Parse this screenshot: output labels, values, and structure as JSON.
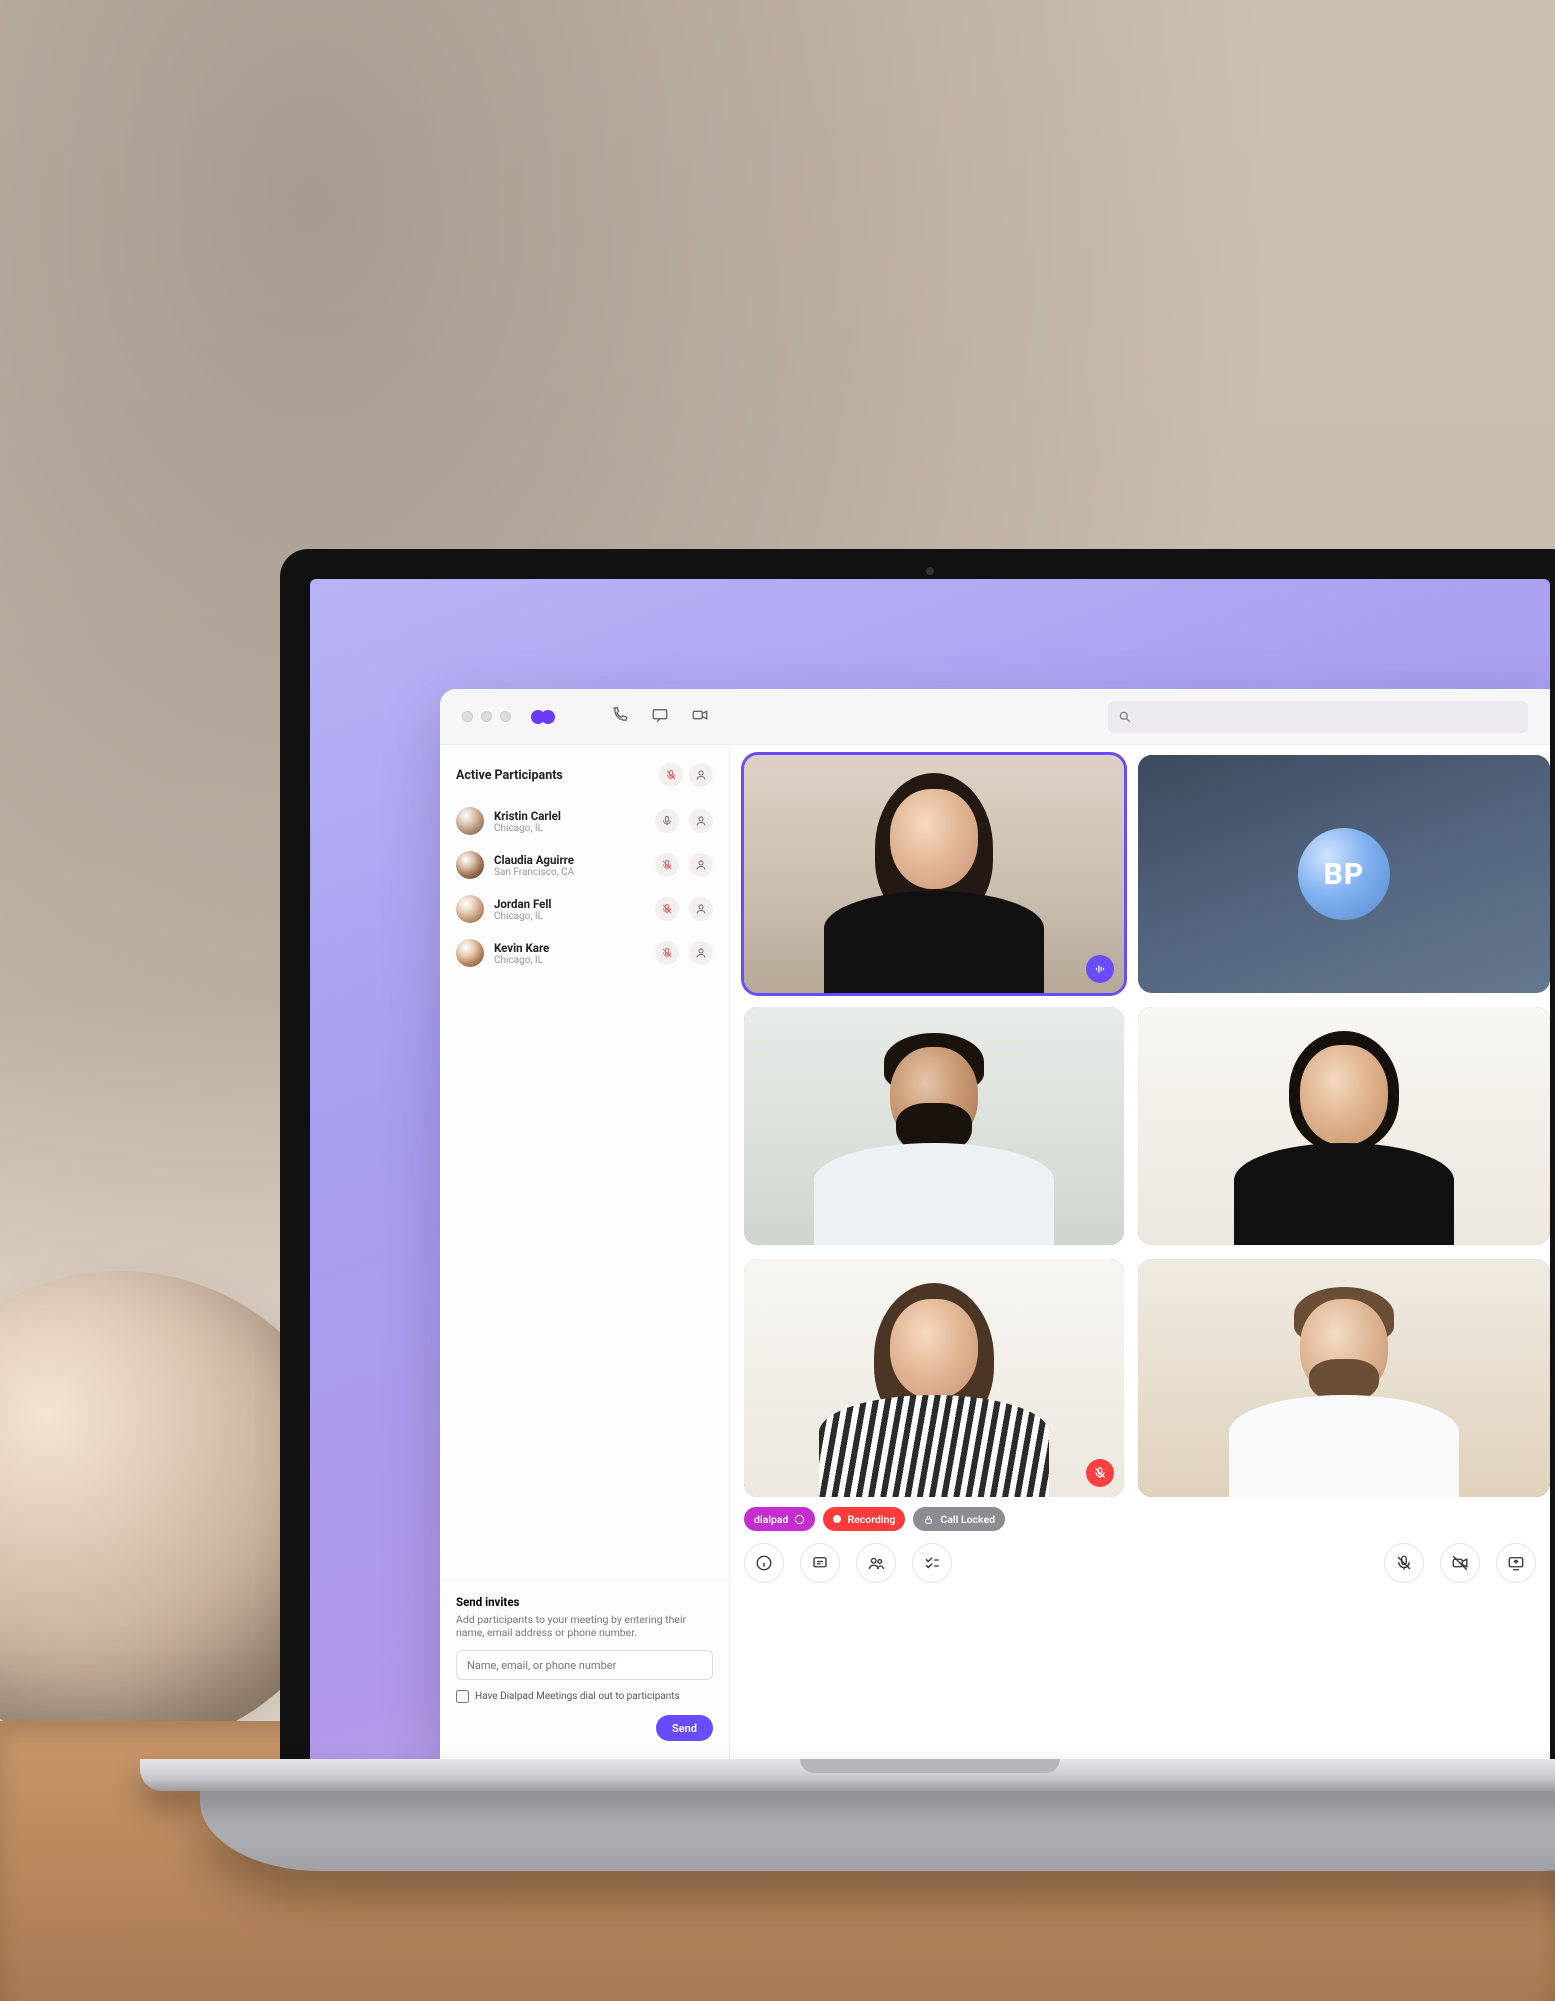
{
  "brand": "dialpad",
  "sidebar": {
    "title": "Active Participants",
    "items": [
      {
        "name": "Kristin Carlel",
        "location": "Chicago, IL",
        "mic": "on"
      },
      {
        "name": "Claudia Aguirre",
        "location": "San Francisco, CA",
        "mic": "off"
      },
      {
        "name": "Jordan Fell",
        "location": "Chicago, IL",
        "mic": "off"
      },
      {
        "name": "Kevin Kare",
        "location": "Chicago, IL",
        "mic": "off"
      }
    ]
  },
  "invites": {
    "title": "Send invites",
    "desc": "Add participants to your meeting by entering their name, email address or phone number.",
    "placeholder": "Name, email, or phone number",
    "checkbox": "Have Dialpad Meetings dial out to participants",
    "send": "Send"
  },
  "tiles": {
    "initials": "BP"
  },
  "status": {
    "brand": "dialpad",
    "recording": "Recording",
    "locked": "Call Locked"
  }
}
